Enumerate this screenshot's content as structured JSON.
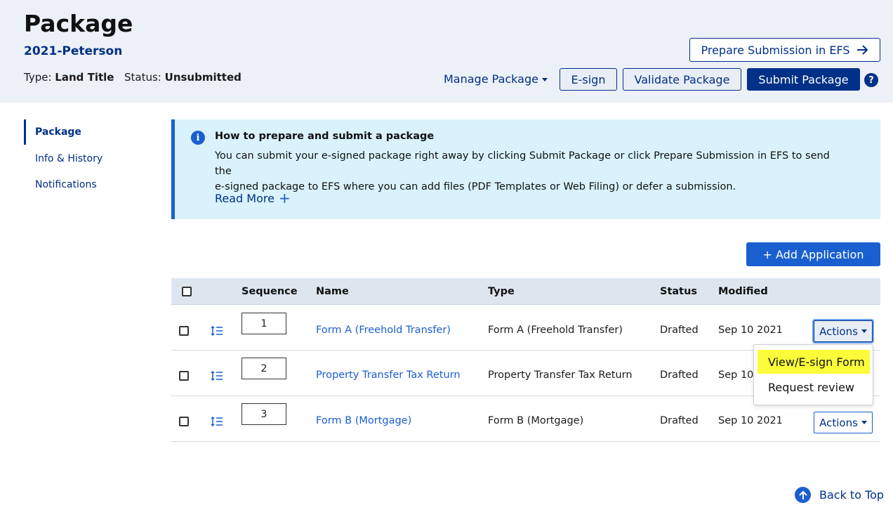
{
  "header": {
    "title": "Package",
    "package_name": "2021-Peterson",
    "type_label": "Type:",
    "type_value": "Land Title",
    "status_label": "Status:",
    "status_value": "Unsubmitted",
    "prepare_efs_label": "Prepare Submission in EFS",
    "manage_label": "Manage Package",
    "esign_label": "E-sign",
    "validate_label": "Validate Package",
    "submit_label": "Submit Package",
    "help_glyph": "?"
  },
  "sidebar": {
    "items": [
      {
        "label": "Package",
        "active": true
      },
      {
        "label": "Info & History",
        "active": false
      },
      {
        "label": "Notifications",
        "active": false
      }
    ]
  },
  "info": {
    "icon_glyph": "i",
    "title": "How to prepare and submit a package",
    "body_line1": "You can submit your e-signed package right away by clicking Submit Package or click Prepare Submission in EFS to send the",
    "body_line2": "e-signed package to EFS where you can add files (PDF Templates or Web Filing) or defer a submission.",
    "read_more": "Read More",
    "read_more_icon": "+"
  },
  "add_application_label": "+ Add Application",
  "table": {
    "columns": [
      "Sequence",
      "Name",
      "Type",
      "Status",
      "Modified"
    ],
    "rows": [
      {
        "sequence": "1",
        "name": "Form A (Freehold Transfer)",
        "type": "Form A (Freehold Transfer)",
        "status": "Drafted",
        "modified": "Sep 10 2021",
        "actions": "Actions"
      },
      {
        "sequence": "2",
        "name": "Property Transfer Tax Return",
        "type": "Property Transfer Tax Return",
        "status": "Drafted",
        "modified": "Sep 10",
        "actions": ""
      },
      {
        "sequence": "3",
        "name": "Form B (Mortgage)",
        "type": "Form B (Mortgage)",
        "status": "Drafted",
        "modified": "Sep 10 2021",
        "actions": "Actions"
      }
    ]
  },
  "dropdown": {
    "items": [
      "View/E-sign Form",
      "Request review"
    ],
    "highlight_color": "#fcfc3a"
  },
  "back_to_top": "Back to Top",
  "colors": {
    "primary": "#003087",
    "link": "#1a5fd0",
    "header_bg": "#ecf0f7",
    "info_bg": "#d9f2fb"
  }
}
